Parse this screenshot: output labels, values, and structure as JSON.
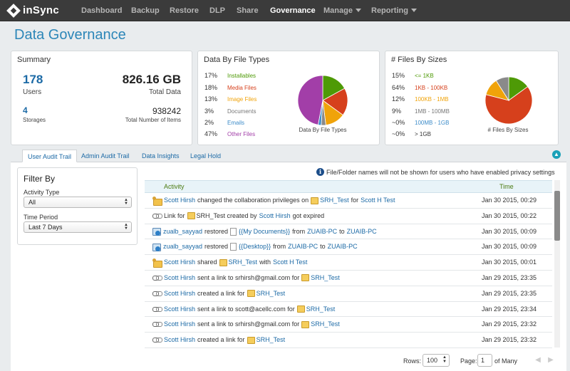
{
  "app": {
    "logo": "inSync"
  },
  "nav": {
    "items": [
      {
        "label": "Dashboard"
      },
      {
        "label": "Backup"
      },
      {
        "label": "Restore"
      },
      {
        "label": "DLP"
      },
      {
        "label": "Share"
      },
      {
        "label": "Governance"
      },
      {
        "label": "Manage"
      },
      {
        "label": "Reporting"
      }
    ],
    "active": "Governance"
  },
  "page": {
    "title": "Data Governance"
  },
  "summary": {
    "title": "Summary",
    "users_value": "178",
    "users_label": "Users",
    "total_data_value": "826.16 GB",
    "total_data_label": "Total Data",
    "storages_value": "4",
    "storages_label": "Storages",
    "items_value": "938242",
    "items_label": "Total Number of Items"
  },
  "file_types": {
    "title": "Data By File Types",
    "caption": "Data By File Types",
    "legend": [
      {
        "pct": "17%",
        "label": "Installables",
        "color": "#4e9a06"
      },
      {
        "pct": "18%",
        "label": "Media Files",
        "color": "#d6401c"
      },
      {
        "pct": "13%",
        "label": "Image Files",
        "color": "#f0a30a"
      },
      {
        "pct": "3%",
        "label": "Documents",
        "color": "#8a8a8a"
      },
      {
        "pct": "2%",
        "label": "Emails",
        "color": "#3d8cc9"
      },
      {
        "pct": "47%",
        "label": "Other Files",
        "color": "#a23ea8"
      }
    ]
  },
  "file_sizes": {
    "title": "# Files By Sizes",
    "caption": "# Files By Sizes",
    "legend": [
      {
        "pct": "15%",
        "label": "<= 1KB",
        "color": "#4e9a06"
      },
      {
        "pct": "64%",
        "label": "1KB - 100KB",
        "color": "#d6401c"
      },
      {
        "pct": "12%",
        "label": "100KB - 1MB",
        "color": "#f0a30a"
      },
      {
        "pct": "9%",
        "label": "1MB - 100MB",
        "color": "#8a8a8a"
      },
      {
        "pct": "~0%",
        "label": "100MB - 1GB",
        "color": "#3d8cc9"
      },
      {
        "pct": "~0%",
        "label": "> 1GB",
        "color": "#a23ea8"
      }
    ]
  },
  "tabs": [
    {
      "label": "User Audit Trail"
    },
    {
      "label": "Admin Audit Trail"
    },
    {
      "label": "Data Insights"
    },
    {
      "label": "Legal Hold"
    }
  ],
  "filter": {
    "title": "Filter By",
    "activity_label": "Activity Type",
    "activity_value": "All",
    "period_label": "Time Period",
    "period_value": "Last 7 Days"
  },
  "notice": "File/Folder names will not be shown for users who have enabled privacy settings",
  "table": {
    "col_activity": "Activity",
    "col_time": "Time",
    "rows": [
      {
        "icon": "share",
        "parts": [
          [
            "l",
            "Scott Hirsh"
          ],
          [
            "t",
            "changed the collaboration privileges on"
          ],
          [
            "f",
            ""
          ],
          [
            "l",
            "SRH_Test"
          ],
          [
            "t",
            "for"
          ],
          [
            "l",
            "Scott H Test"
          ]
        ],
        "time": "Jan 30 2015, 00:29"
      },
      {
        "icon": "link",
        "parts": [
          [
            "t",
            "Link for"
          ],
          [
            "f",
            ""
          ],
          [
            "t",
            "SRH_Test created by"
          ],
          [
            "l",
            "Scott Hirsh"
          ],
          [
            "t",
            "got expired"
          ]
        ],
        "time": "Jan 30 2015, 00:22"
      },
      {
        "icon": "restore",
        "parts": [
          [
            "l",
            "zualb_sayyad"
          ],
          [
            "t",
            "restored"
          ],
          [
            "d",
            ""
          ],
          [
            "l",
            "{{My Documents}}"
          ],
          [
            "t",
            "from"
          ],
          [
            "l",
            "ZUAIB-PC"
          ],
          [
            "t",
            "to"
          ],
          [
            "l",
            "ZUAIB-PC"
          ]
        ],
        "time": "Jan 30 2015, 00:09"
      },
      {
        "icon": "restore",
        "parts": [
          [
            "l",
            "zualb_sayyad"
          ],
          [
            "t",
            "restored"
          ],
          [
            "d",
            ""
          ],
          [
            "l",
            "{{Desktop}}"
          ],
          [
            "t",
            "from"
          ],
          [
            "l",
            "ZUAIB-PC"
          ],
          [
            "t",
            "to"
          ],
          [
            "l",
            "ZUAIB-PC"
          ]
        ],
        "time": "Jan 30 2015, 00:09"
      },
      {
        "icon": "share",
        "parts": [
          [
            "l",
            "Scott Hirsh"
          ],
          [
            "t",
            "shared"
          ],
          [
            "f",
            ""
          ],
          [
            "l",
            "SRH_Test"
          ],
          [
            "t",
            "with"
          ],
          [
            "l",
            "Scott H Test"
          ]
        ],
        "time": "Jan 30 2015, 00:01"
      },
      {
        "icon": "link",
        "parts": [
          [
            "l",
            "Scott Hirsh"
          ],
          [
            "t",
            "sent a link to srhirsh@gmail.com for"
          ],
          [
            "f",
            ""
          ],
          [
            "l",
            "SRH_Test"
          ]
        ],
        "time": "Jan 29 2015, 23:35"
      },
      {
        "icon": "link",
        "parts": [
          [
            "l",
            "Scott Hirsh"
          ],
          [
            "t",
            "created a link for"
          ],
          [
            "f",
            ""
          ],
          [
            "l",
            "SRH_Test"
          ]
        ],
        "time": "Jan 29 2015, 23:35"
      },
      {
        "icon": "link",
        "parts": [
          [
            "l",
            "Scott Hirsh"
          ],
          [
            "t",
            "sent a link to scott@acellc.com for"
          ],
          [
            "f",
            ""
          ],
          [
            "l",
            "SRH_Test"
          ]
        ],
        "time": "Jan 29 2015, 23:34"
      },
      {
        "icon": "link",
        "parts": [
          [
            "l",
            "Scott Hirsh"
          ],
          [
            "t",
            "sent a link to srhirsh@gmail.com for"
          ],
          [
            "f",
            ""
          ],
          [
            "l",
            "SRH_Test"
          ]
        ],
        "time": "Jan 29 2015, 23:32"
      },
      {
        "icon": "link",
        "parts": [
          [
            "l",
            "Scott Hirsh"
          ],
          [
            "t",
            "created a link for"
          ],
          [
            "f",
            ""
          ],
          [
            "l",
            "SRH_Test"
          ]
        ],
        "time": "Jan 29 2015, 23:32"
      }
    ]
  },
  "pager": {
    "rows_label": "Rows:",
    "rows_value": "100",
    "page_label": "Page:",
    "page_value": "1",
    "of_label": "of Many"
  }
}
